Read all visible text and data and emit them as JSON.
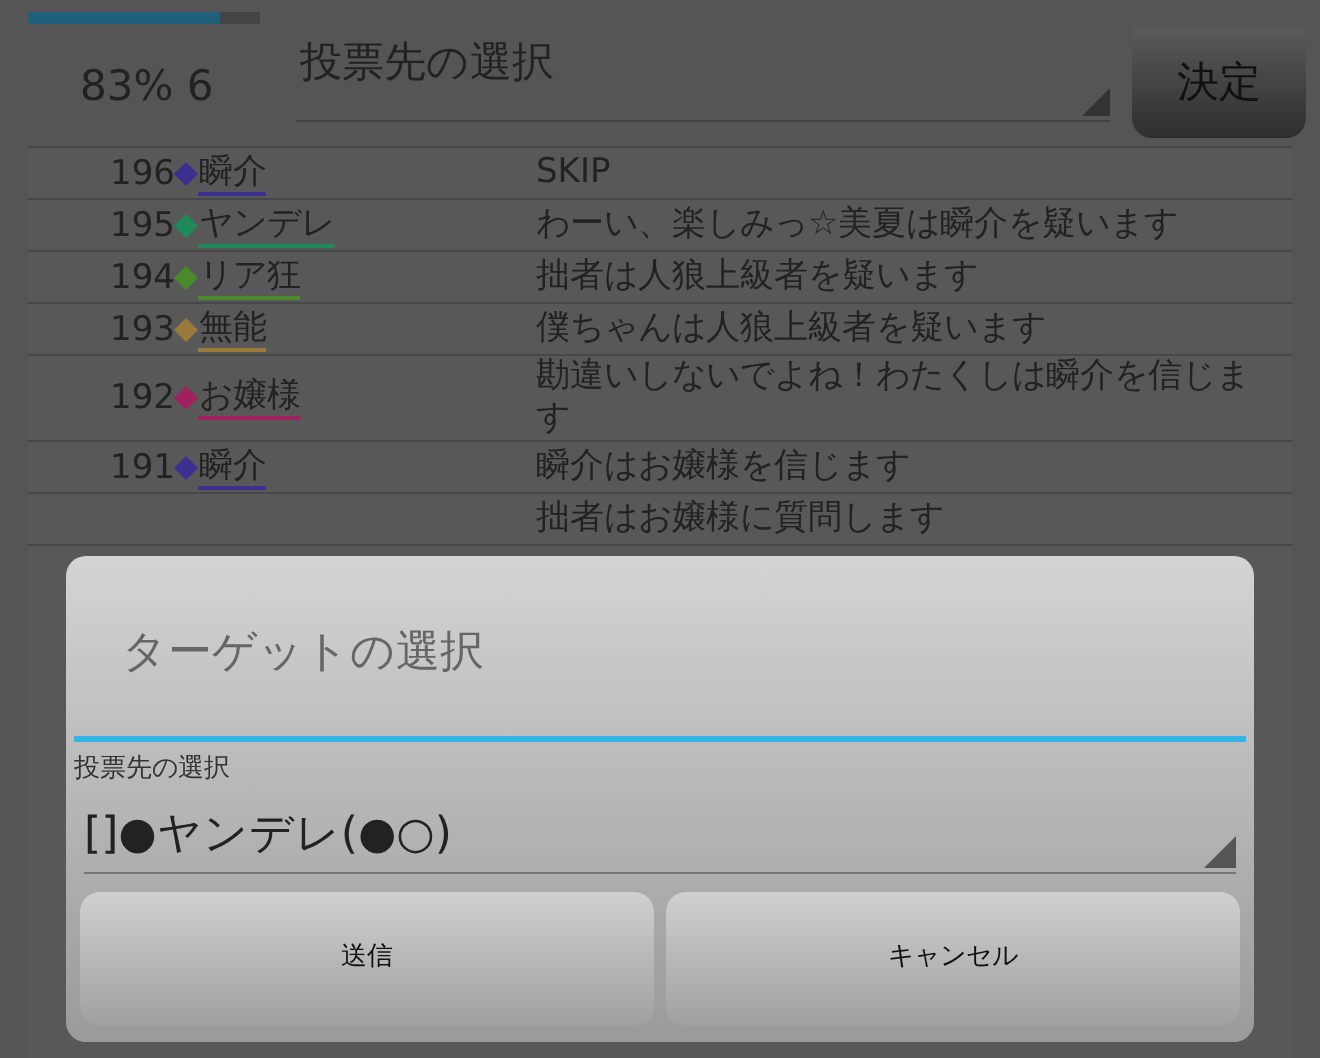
{
  "header": {
    "progress": {
      "level": 0.83
    },
    "status": "83% 6",
    "dropdown": {
      "value": "投票先の選択"
    },
    "confirm_button": "決定"
  },
  "log": [
    {
      "number": "196",
      "name": "瞬介",
      "color": "#3a3090",
      "message": "SKIP"
    },
    {
      "number": "195",
      "name": "ヤンデレ",
      "color": "#1f8a5a",
      "message": "わーい、楽しみっ☆美夏は瞬介を疑います"
    },
    {
      "number": "194",
      "name": "リア狂",
      "color": "#4a8a2a",
      "message": "拙者は人狼上級者を疑います"
    },
    {
      "number": "193",
      "name": "無能",
      "color": "#9a7a3a",
      "message": "僕ちゃんは人狼上級者を疑います"
    },
    {
      "number": "192",
      "name": "お嬢様",
      "color": "#a02060",
      "message": "勘違いしないでよね！わたくしは瞬介を信じます"
    },
    {
      "number": "191",
      "name": "瞬介",
      "color": "#3a3090",
      "message": "瞬介はお嬢様を信じます"
    },
    {
      "message": "拙者はお嬢様に質問します"
    }
  ],
  "dialog": {
    "title": "ターゲットの選択",
    "label": "投票先の選択",
    "spinner": {
      "value": "[]●ヤンデレ(●○)"
    },
    "buttons": [
      "送信",
      "キャンセル"
    ]
  }
}
